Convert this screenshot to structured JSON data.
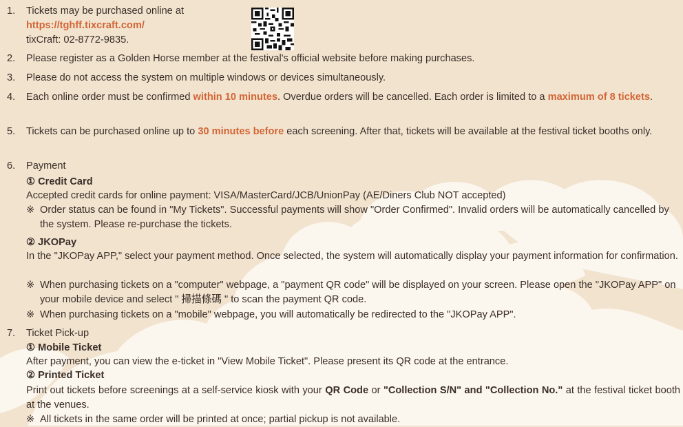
{
  "items": {
    "i1": {
      "num": "1.",
      "line1": "Tickets may be purchased online at",
      "link": "https://tghff.tixcraft.com/",
      "line3": "tixCraft: 02-8772-9835."
    },
    "i2": {
      "num": "2.",
      "text": "Please register as a Golden Horse member at the festival's official website before making purchases."
    },
    "i3": {
      "num": "3.",
      "text": "Please do not access the system on multiple windows or devices simultaneously."
    },
    "i4": {
      "num": "4.",
      "a": "Each online order must be confirmed ",
      "b": "within 10 minutes",
      "c": ". Overdue orders will be cancelled. Each order is limited to a ",
      "d": "maximum of 8 tickets",
      "e": "."
    },
    "i5": {
      "num": "5.",
      "a": "Tickets can be purchased online up to ",
      "b": "30 minutes before",
      "c": " each screening. After that, tickets will be available at the festival ticket booths only."
    },
    "i6": {
      "num": "6.",
      "label": "Payment",
      "cc_title": "① Credit Card",
      "cc_text": "Accepted credit cards for online payment: VISA/MasterCard/JCB/UnionPay (AE/Diners Club NOT accepted)",
      "cc_note": "Order status can be found in \"My Tickets\". Successful payments will show \"Order Confirmed\". Invalid orders will be automatically cancelled by the system. Please re-purchase the tickets.",
      "jko_title": "② JKOPay",
      "jko_text": "In the \"JKOPay APP,\" select your payment method. Once selected, the system will automatically display your payment information for confirmation.",
      "jko_note1": "When purchasing tickets on a \"computer\" webpage, a \"payment QR code\" will be displayed on your screen. Please open the \"JKOPay APP\" on your mobile device and select \" 掃描條碼 \" to scan the payment QR code.",
      "jko_note2": "When purchasing tickets on a \"mobile\" webpage, you will automatically be redirected to the \"JKOPay APP\"."
    },
    "i7": {
      "num": "7.",
      "label": "Ticket Pick-up",
      "mobile_title": "① Mobile Ticket",
      "mobile_text": "After payment, you can view the e-ticket in \"View Mobile Ticket\". Please present its QR code at the entrance.",
      "printed_title": "② Printed Ticket",
      "printed_a": "Print out tickets before screenings at a self-service kiosk with your ",
      "printed_b": "QR Code",
      "printed_c": " or ",
      "printed_d": "\"Collection S/N\" and \"Collection No.\"",
      "printed_e": " at the festival ticket booth at the venues.",
      "printed_note": "All tickets in the same order will be printed at once; partial pickup is not available."
    }
  },
  "note_mark": "※",
  "colors": {
    "accent": "#d36535",
    "background": "#f2e3cf",
    "cloud": "#fbf5ec",
    "text": "#3a2e28"
  },
  "icons": {
    "qr": "qr-code-icon"
  }
}
